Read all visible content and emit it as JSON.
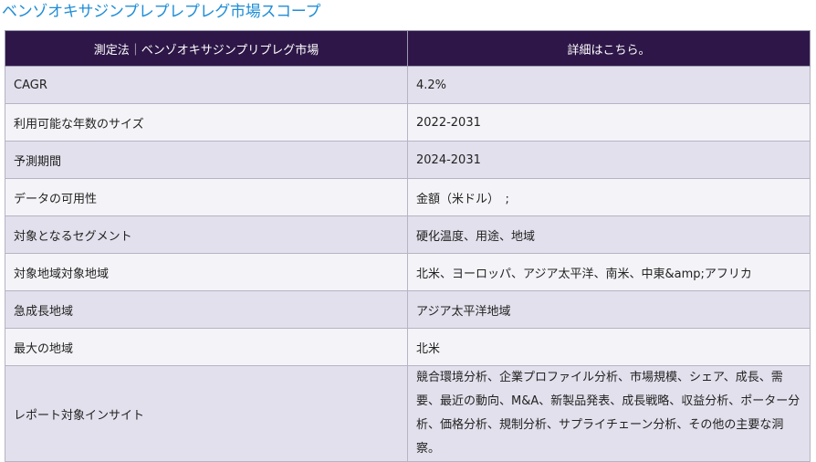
{
  "title": "ベンゾオキサジンプレプレプレグ市場スコープ",
  "table": {
    "header": {
      "col1": "測定法｜ベンゾオキサジンプリプレグ市場",
      "col2": "詳細はこちら。"
    },
    "rows": [
      {
        "label": "CAGR",
        "value": "4.2%"
      },
      {
        "label": "利用可能な年数のサイズ",
        "value": "2022-2031"
      },
      {
        "label": "予測期間",
        "value": "2024-2031"
      },
      {
        "label": "データの可用性",
        "value": "金額（米ドル）　;"
      },
      {
        "label": "対象となるセグメント",
        "value": "硬化温度、用途、地域"
      },
      {
        "label": "対象地域対象地域",
        "value": "北米、ヨーロッパ、アジア太平洋、南米、中東&amp;アフリカ"
      },
      {
        "label": "急成長地域",
        "value": "アジア太平洋地域"
      },
      {
        "label": "最大の地域",
        "value": "北米"
      },
      {
        "label": "レポート対象インサイト",
        "value": "競合環境分析、企業プロファイル分析、市場規模、シェア、成長、需要、最近の動向、M&A、新製品発表、成長戦略、収益分析、ポーター分析、価格分析、規制分析、サプライチェーン分析、その他の主要な洞察。"
      }
    ]
  }
}
